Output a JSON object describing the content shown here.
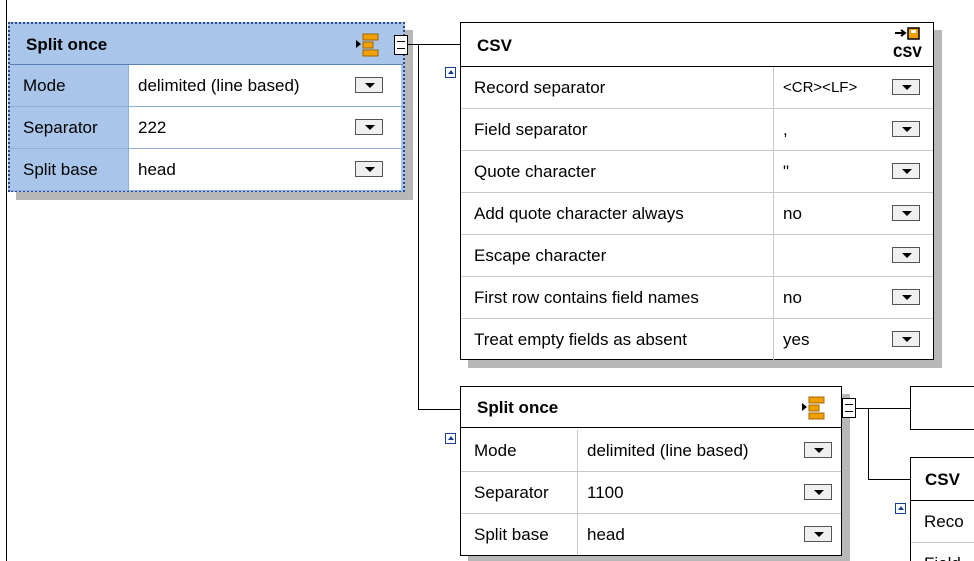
{
  "split_node_1": {
    "title": "Split once",
    "rows": [
      {
        "label": "Mode",
        "value": "delimited (line based)"
      },
      {
        "label": "Separator",
        "value": "222"
      },
      {
        "label": "Split base",
        "value": "head"
      }
    ]
  },
  "csv_node_1": {
    "title": "CSV",
    "icon_label": "CSV",
    "rows": [
      {
        "label": "Record separator",
        "value": "<CR><LF>"
      },
      {
        "label": "Field separator",
        "value": ","
      },
      {
        "label": "Quote character",
        "value": "\""
      },
      {
        "label": "Add quote character always",
        "value": "no"
      },
      {
        "label": "Escape character",
        "value": ""
      },
      {
        "label": "First row contains field names",
        "value": "no"
      },
      {
        "label": "Treat empty fields as absent",
        "value": "yes"
      }
    ]
  },
  "split_node_2": {
    "title": "Split once",
    "rows": [
      {
        "label": "Mode",
        "value": "delimited (line based)"
      },
      {
        "label": "Separator",
        "value": "1100"
      },
      {
        "label": "Split base",
        "value": "head"
      }
    ]
  },
  "csv_node_2": {
    "title": "CSV",
    "rows": [
      {
        "label": "Reco"
      },
      {
        "label": "Field"
      }
    ]
  },
  "colors": {
    "selected_bg": "#a9c6ea",
    "node_shadow": "#b8b8b8",
    "split_icon": "#f0a000",
    "collapse_arrow": "#1a3f8f"
  },
  "icons": [
    "split-icon",
    "csv-icon",
    "dropdown-arrow-icon",
    "collapse-icon",
    "output-port-icon"
  ]
}
